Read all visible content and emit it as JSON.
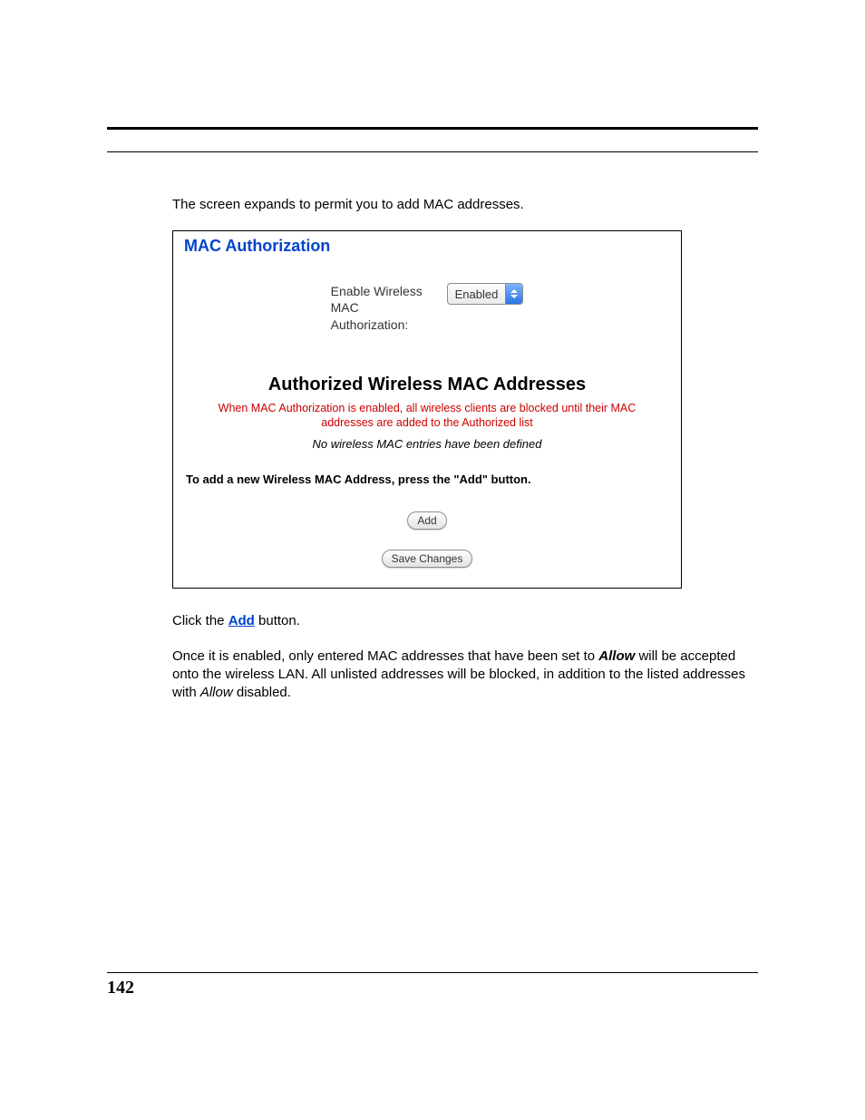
{
  "page_number": "142",
  "intro_text": "The screen expands to permit you to add MAC addresses.",
  "panel": {
    "title": "MAC Authorization",
    "enable_label": "Enable Wireless MAC Authorization:",
    "select_value": "Enabled",
    "section_heading": "Authorized Wireless MAC Addresses",
    "warning_text": "When MAC Authorization is enabled, all wireless clients are blocked until their MAC addresses are added to the Authorized list",
    "empty_text": "No wireless MAC entries have been defined",
    "instruction_text": "To add a new Wireless MAC Address, press the \"Add\" button.",
    "add_btn": "Add",
    "save_btn": "Save Changes"
  },
  "after": {
    "click_prefix": "Click the ",
    "click_link": "Add",
    "click_suffix": " button.",
    "para2_a": "Once it is enabled, only entered MAC addresses that have been set to ",
    "para2_allow1": "Allow",
    "para2_b": " will be accepted onto the wireless LAN. All unlisted addresses will be blocked, in addition to the listed addresses with ",
    "para2_allow2": "Allow",
    "para2_c": " disabled."
  }
}
